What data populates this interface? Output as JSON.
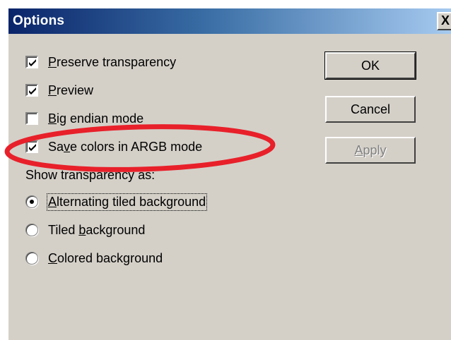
{
  "window": {
    "title": "Options",
    "close_glyph": "X"
  },
  "options": {
    "preserve_transparency": {
      "label_pre": "",
      "label_u": "P",
      "label_post": "reserve transparency",
      "checked": true
    },
    "preview": {
      "label_pre": "",
      "label_u": "P",
      "label_post": "review",
      "checked": true
    },
    "big_endian": {
      "label_pre": "",
      "label_u": "B",
      "label_post": "ig endian mode",
      "checked": false
    },
    "save_argb": {
      "label_pre": "Sa",
      "label_u": "v",
      "label_post": "e colors in ARGB mode",
      "checked": true
    }
  },
  "transparency": {
    "heading": "Show transparency as:",
    "options": [
      {
        "label_pre": "",
        "label_u": "A",
        "label_post": "lternating tiled background",
        "selected": true
      },
      {
        "label_pre": "Tiled ",
        "label_u": "b",
        "label_post": "ackground",
        "selected": false
      },
      {
        "label_pre": "",
        "label_u": "C",
        "label_post": "olored background",
        "selected": false
      }
    ]
  },
  "buttons": {
    "ok": {
      "label": "OK"
    },
    "cancel": {
      "label": "Cancel"
    },
    "apply": {
      "label_pre": "",
      "label_u": "A",
      "label_post": "pply",
      "enabled": false
    }
  },
  "colors": {
    "annotation_ellipse": "#e8202a",
    "titlebar_start": "#0a246a",
    "dialog_face": "#d4d0c8"
  }
}
